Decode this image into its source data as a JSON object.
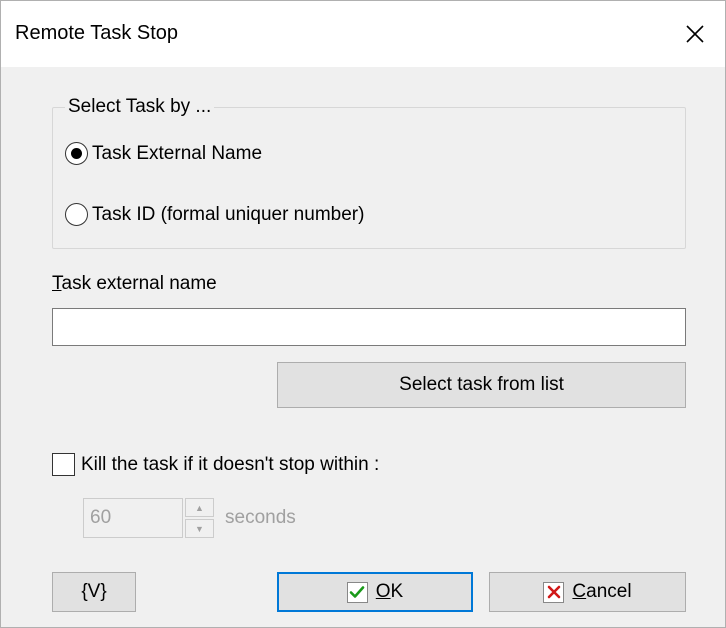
{
  "window": {
    "title": "Remote Task Stop"
  },
  "select_group": {
    "legend": "Select Task by ...",
    "options": [
      {
        "label": "Task External Name",
        "selected": true
      },
      {
        "label": "Task ID (formal uniquer number)",
        "selected": false
      }
    ]
  },
  "external_name": {
    "label_first": "T",
    "label_rest": "ask external name",
    "value": ""
  },
  "select_task_button": {
    "label": "Select task from list"
  },
  "kill": {
    "label": "Kill the task if it doesn't stop within :",
    "checked": false,
    "seconds_value": "60",
    "unit": "seconds"
  },
  "buttons": {
    "vars_label": "{V}",
    "ok_first": "O",
    "ok_rest": "K",
    "cancel_first": "C",
    "cancel_rest": "ancel"
  },
  "icons": {
    "close": "close-icon",
    "ok": "check-icon",
    "cancel": "x-icon",
    "ok_color": "#1a9a1a",
    "cancel_color": "#d01818"
  }
}
